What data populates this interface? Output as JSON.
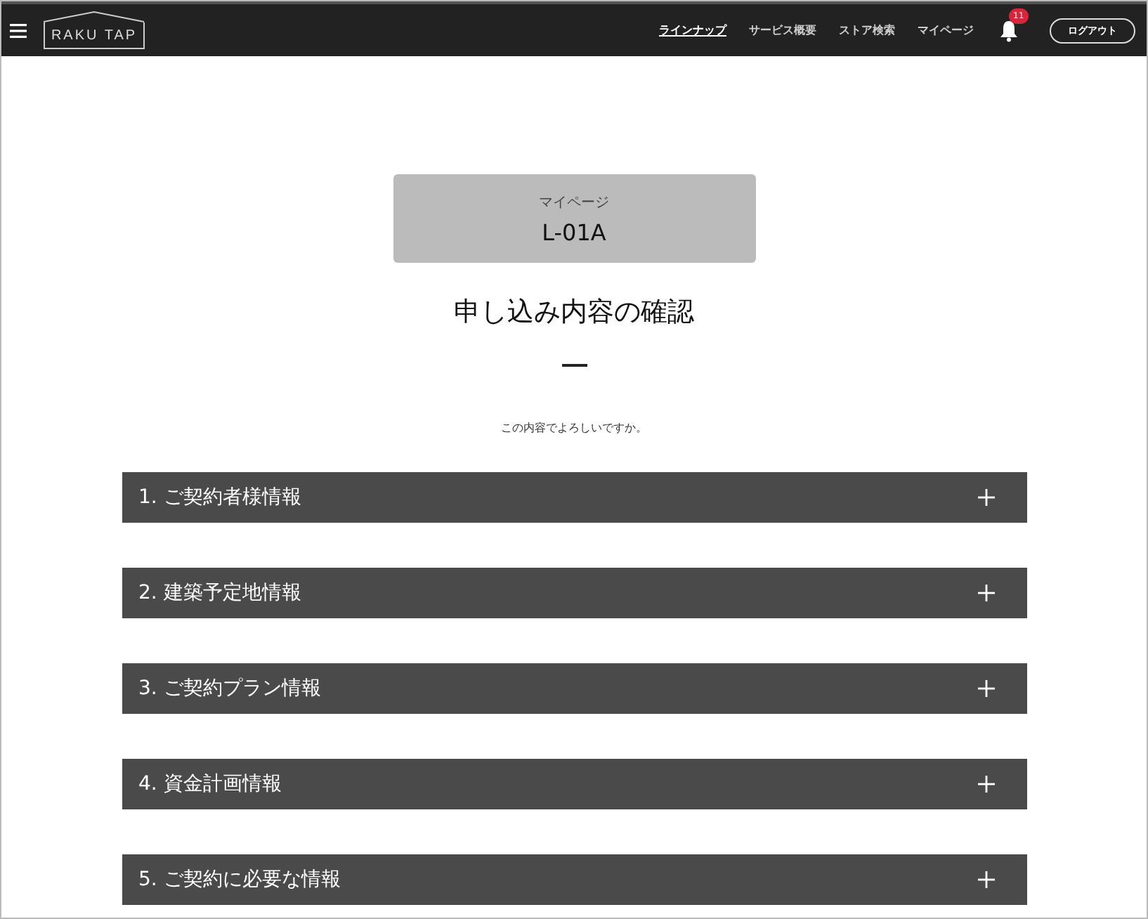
{
  "header": {
    "logo": "RAKU TAP",
    "nav": [
      {
        "label": "ラインナップ",
        "selected": true
      },
      {
        "label": "サービス概要",
        "selected": false
      },
      {
        "label": "ストア検索",
        "selected": false
      },
      {
        "label": "マイページ",
        "selected": false
      }
    ],
    "notification_count": "11",
    "logout_button": "ログアウト"
  },
  "page_card": {
    "label": "マイページ",
    "value": "L-01A"
  },
  "title": "申し込み内容の確認",
  "message": "この内容でよろしいですか。",
  "sections": [
    {
      "label": "1. ご契約者様情報",
      "expanded": false
    },
    {
      "label": "2. 建築予定地情報",
      "expanded": false
    },
    {
      "label": "3. ご契約プラン情報",
      "expanded": false
    },
    {
      "label": "4. 資金計画情報",
      "expanded": false
    },
    {
      "label": "5. ご契約に必要な情報",
      "expanded": false
    }
  ]
}
